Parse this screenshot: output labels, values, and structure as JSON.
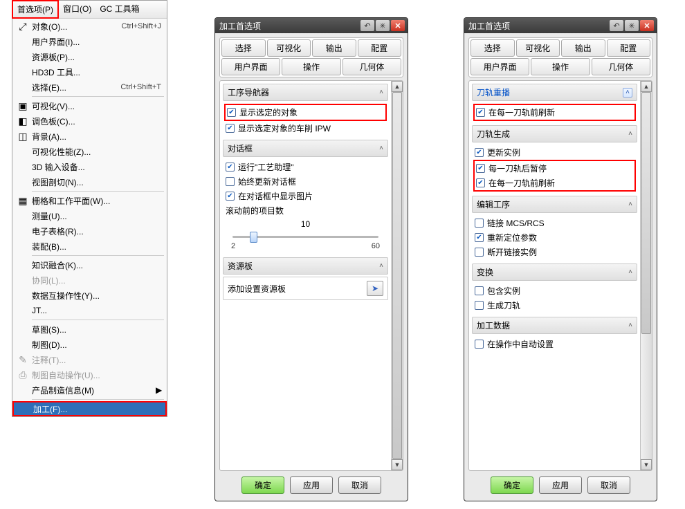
{
  "menubar": {
    "pref": "首选项(P)",
    "window": "窗口(O)",
    "toolbox": "GC 工具箱"
  },
  "menu": {
    "items": [
      {
        "label": "对象(O)...",
        "shortcut": "Ctrl+Shift+J",
        "icon": "⤢",
        "arrow": false
      },
      {
        "label": "用户界面(I)...",
        "arrow": false
      },
      {
        "label": "资源板(P)...",
        "arrow": false
      },
      {
        "label": "HD3D 工具...",
        "arrow": false
      },
      {
        "label": "选择(E)...",
        "shortcut": "Ctrl+Shift+T",
        "arrow": false
      },
      {
        "sep": true
      },
      {
        "label": "可视化(V)...",
        "icon": "▣",
        "arrow": false
      },
      {
        "label": "调色板(C)...",
        "icon": "◧",
        "arrow": false
      },
      {
        "label": "背景(A)...",
        "icon": "◫",
        "arrow": false
      },
      {
        "label": "可视化性能(Z)...",
        "arrow": false
      },
      {
        "label": "3D 输入设备...",
        "arrow": false
      },
      {
        "label": "视图剖切(N)...",
        "arrow": false
      },
      {
        "sep": true
      },
      {
        "label": "栅格和工作平面(W)...",
        "icon": "▦",
        "arrow": false
      },
      {
        "label": "测量(U)...",
        "arrow": false
      },
      {
        "label": "电子表格(R)...",
        "arrow": false
      },
      {
        "label": "装配(B)...",
        "arrow": false
      },
      {
        "sep": true
      },
      {
        "label": "知识融合(K)...",
        "arrow": false
      },
      {
        "label": "协同(L)...",
        "disabled": true,
        "arrow": false
      },
      {
        "label": "数据互操作性(Y)...",
        "arrow": false
      },
      {
        "label": "JT...",
        "arrow": false
      },
      {
        "sep": true
      },
      {
        "label": "草图(S)...",
        "arrow": false
      },
      {
        "label": "制图(D)...",
        "arrow": false
      },
      {
        "label": "注释(T)...",
        "icon": "✎",
        "disabled": true,
        "arrow": false
      },
      {
        "label": "制图自动操作(U)...",
        "icon": "⎙",
        "disabled": true,
        "arrow": false
      },
      {
        "label": "产品制造信息(M)",
        "arrow": true
      },
      {
        "sep": true
      },
      {
        "label": "加工(F)...",
        "selected": true,
        "arrow": false
      }
    ]
  },
  "dialog": {
    "title": "加工首选项",
    "tabs_row1": [
      "选择",
      "可视化",
      "输出",
      "配置"
    ],
    "tabs_row2": [
      "用户界面",
      "操作",
      "几何体"
    ],
    "buttons": {
      "ok": "确定",
      "apply": "应用",
      "cancel": "取消"
    }
  },
  "panel1": {
    "section_nav": "工序导航器",
    "chk_show_selected": "显示选定的对象",
    "chk_show_ipw": "显示选定对象的车削 IPW",
    "section_dialog": "对话框",
    "chk_run_tech": "运行\"工艺助理\"",
    "chk_always_update": "始终更新对话框",
    "chk_show_pics": "在对话框中显示图片",
    "scroll_label": "滚动前的项目数",
    "slider_value": "10",
    "slider_min": "2",
    "slider_max": "60",
    "section_res": "资源板",
    "res_label": "添加设置资源板"
  },
  "panel2": {
    "section_replay": "刀轨重播",
    "chk_refresh_before1": "在每一刀轨前刷新",
    "section_gen": "刀轨生成",
    "chk_update_inst": "更新实例",
    "chk_pause_each": "每一刀轨后暂停",
    "chk_refresh_before2": "在每一刀轨前刷新",
    "section_edit": "编辑工序",
    "chk_link_mcs": "链接 MCS/RCS",
    "chk_reset_params": "重新定位参数",
    "chk_break_link": "断开链接实例",
    "section_trans": "变换",
    "chk_inc_inst": "包含实例",
    "chk_gen_path": "生成刀轨",
    "section_data": "加工数据",
    "chk_auto_set": "在操作中自动设置"
  }
}
